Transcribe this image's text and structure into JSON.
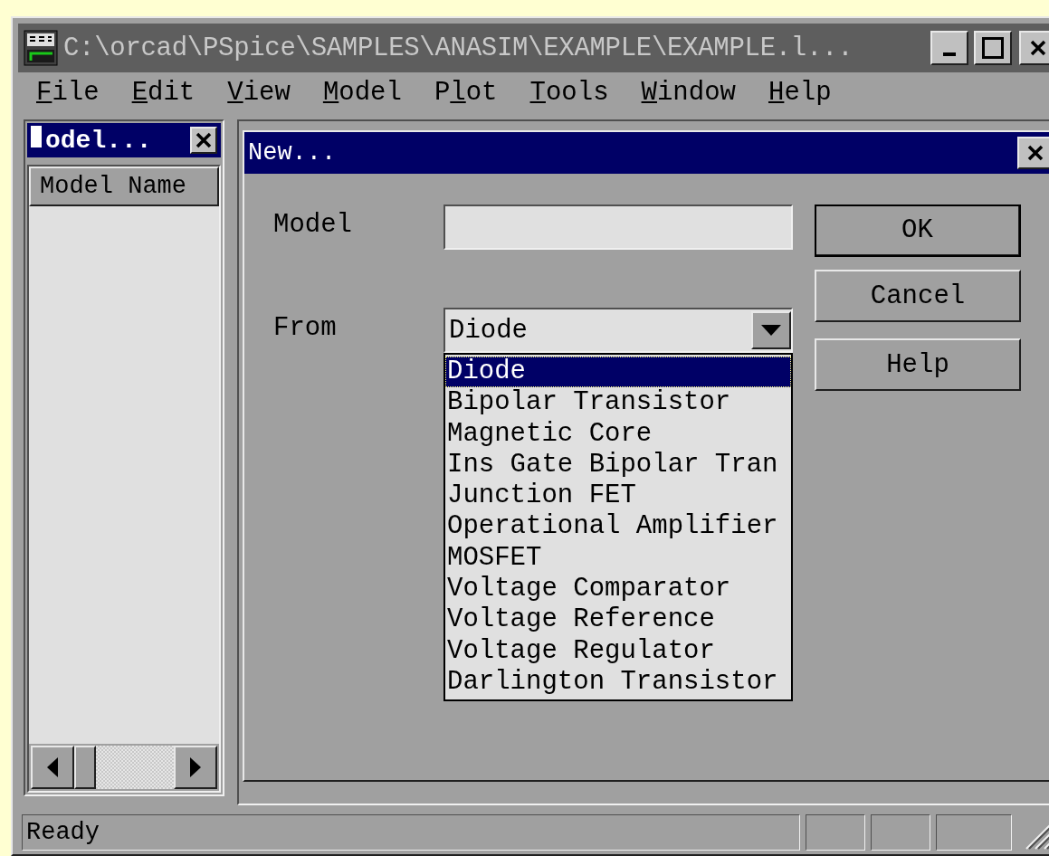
{
  "window": {
    "title": "C:\\orcad\\PSpice\\SAMPLES\\ANASIM\\EXAMPLE\\EXAMPLE.l..."
  },
  "menu": [
    {
      "key": "F",
      "after": "ile"
    },
    {
      "key": "E",
      "after": "dit"
    },
    {
      "key": "V",
      "after": "iew"
    },
    {
      "key": "M",
      "after": "odel"
    },
    {
      "before": "P",
      "key": "l",
      "after": "ot"
    },
    {
      "key": "T",
      "after": "ools"
    },
    {
      "key": "W",
      "after": "indow"
    },
    {
      "key": "H",
      "after": "elp"
    }
  ],
  "model_panel": {
    "title": "odel...",
    "column": "Model Name"
  },
  "dialog": {
    "title": "New...",
    "model_field": {
      "label": "Model"
    },
    "from_field": {
      "label": "From",
      "value": "Diode",
      "expanded": true,
      "options": [
        {
          "label": "Diode",
          "selected": true
        },
        {
          "label": "Bipolar Transistor",
          "selected": false
        },
        {
          "label": "Magnetic Core",
          "selected": false
        },
        {
          "label": "Ins Gate Bipolar Tran",
          "selected": false
        },
        {
          "label": "Junction FET",
          "selected": false
        },
        {
          "label": "Operational Amplifier",
          "selected": false
        },
        {
          "label": "MOSFET",
          "selected": false
        },
        {
          "label": "Voltage Comparator",
          "selected": false
        },
        {
          "label": "Voltage Reference",
          "selected": false
        },
        {
          "label": "Voltage Regulator",
          "selected": false
        },
        {
          "label": "Darlington Transistor",
          "selected": false
        }
      ]
    },
    "buttons": [
      {
        "label": "OK",
        "default": true
      },
      {
        "label": "Cancel",
        "default": false
      },
      {
        "label": "Help",
        "default": false
      }
    ]
  },
  "status_bar": {
    "text": "Ready"
  }
}
